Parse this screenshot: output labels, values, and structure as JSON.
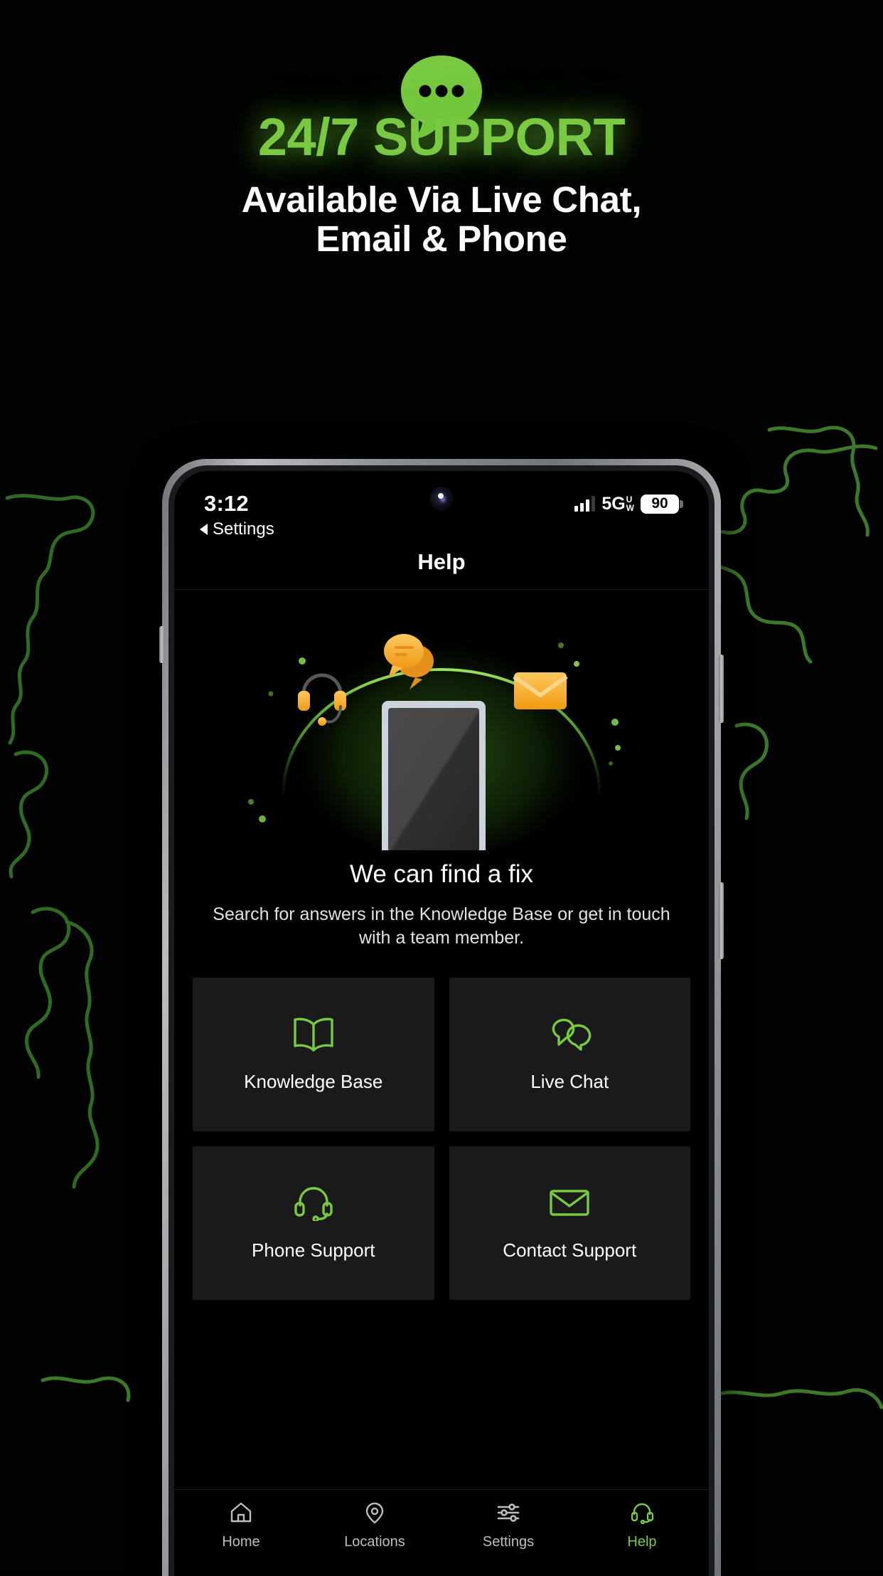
{
  "hero": {
    "icon": "chat-bubble-icon",
    "title": "24/7 SUPPORT",
    "subtitle_line1": "Available Via Live Chat,",
    "subtitle_line2": "Email & Phone",
    "accent_color": "#79c943",
    "title_color": "#79c943",
    "subtitle_color": "#ffffff",
    "background_color": "#000000"
  },
  "phone": {
    "statusbar": {
      "time": "3:12",
      "signal_bars_filled": 3,
      "signal_bars_total": 4,
      "network": "5G",
      "network_superscript_top": "U",
      "network_superscript_bottom": "W",
      "battery_percent": "90"
    },
    "back_button": "Settings",
    "nav_title": "Help",
    "illustration": {
      "device": "smartphone-illustration",
      "arc_color": "#6ec53c",
      "orbit_icons": [
        "chat-bubble-icon",
        "headset-icon",
        "envelope-icon"
      ],
      "orbit_icon_color": "#f5a623"
    },
    "content": {
      "heading": "We can find a fix",
      "description": "Search for answers in the Knowledge Base or get in touch with a team member."
    },
    "cards": [
      {
        "label": "Knowledge Base",
        "icon": "open-book-icon"
      },
      {
        "label": "Live Chat",
        "icon": "chat-bubbles-icon"
      },
      {
        "label": "Phone Support",
        "icon": "headset-icon"
      },
      {
        "label": "Contact Support",
        "icon": "envelope-icon"
      }
    ],
    "tabs": [
      {
        "label": "Home",
        "icon": "home-icon",
        "active": false
      },
      {
        "label": "Locations",
        "icon": "map-pin-icon",
        "active": false
      },
      {
        "label": "Settings",
        "icon": "sliders-icon",
        "active": false
      },
      {
        "label": "Help",
        "icon": "headset-icon",
        "active": true
      }
    ]
  }
}
